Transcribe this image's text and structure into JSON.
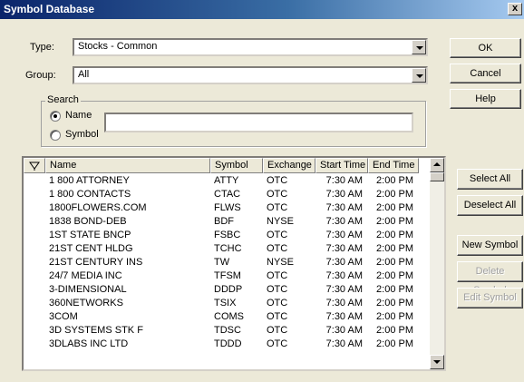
{
  "window": {
    "title": "Symbol Database",
    "close_label": "x"
  },
  "type_field": {
    "label": "Type:",
    "value": "Stocks - Common"
  },
  "group_field": {
    "label": "Group:",
    "value": "All"
  },
  "search": {
    "title": "Search",
    "name_label": "Name",
    "symbol_label": "Symbol",
    "selected": "Name",
    "text": ""
  },
  "buttons": {
    "ok": "OK",
    "cancel": "Cancel",
    "help": "Help",
    "select_all": "Select All",
    "deselect_all": "Deselect All",
    "new_symbol": "New Symbol",
    "delete_symbol": "Delete Symbol",
    "edit_symbol": "Edit Symbol"
  },
  "table": {
    "filter_icon": "filter-icon",
    "columns": [
      "Name",
      "Symbol",
      "Exchange",
      "Start Time",
      "End Time"
    ],
    "rows": [
      [
        "1 800 ATTORNEY",
        "ATTY",
        "OTC",
        "7:30 AM",
        "2:00 PM"
      ],
      [
        "1 800 CONTACTS",
        "CTAC",
        "OTC",
        "7:30 AM",
        "2:00 PM"
      ],
      [
        "1800FLOWERS.COM",
        "FLWS",
        "OTC",
        "7:30 AM",
        "2:00 PM"
      ],
      [
        "1838 BOND-DEB",
        "BDF",
        "NYSE",
        "7:30 AM",
        "2:00 PM"
      ],
      [
        "1ST STATE BNCP",
        "FSBC",
        "OTC",
        "7:30 AM",
        "2:00 PM"
      ],
      [
        "21ST CENT HLDG",
        "TCHC",
        "OTC",
        "7:30 AM",
        "2:00 PM"
      ],
      [
        "21ST CENTURY INS",
        "TW",
        "NYSE",
        "7:30 AM",
        "2:00 PM"
      ],
      [
        "24/7 MEDIA INC",
        "TFSM",
        "OTC",
        "7:30 AM",
        "2:00 PM"
      ],
      [
        "3-DIMENSIONAL",
        "DDDP",
        "OTC",
        "7:30 AM",
        "2:00 PM"
      ],
      [
        "360NETWORKS",
        "TSIX",
        "OTC",
        "7:30 AM",
        "2:00 PM"
      ],
      [
        "3COM",
        "COMS",
        "OTC",
        "7:30 AM",
        "2:00 PM"
      ],
      [
        "3D SYSTEMS STK F",
        "TDSC",
        "OTC",
        "7:30 AM",
        "2:00 PM"
      ],
      [
        "3DLABS INC LTD",
        "TDDD",
        "OTC",
        "7:30 AM",
        "2:00 PM"
      ]
    ]
  }
}
